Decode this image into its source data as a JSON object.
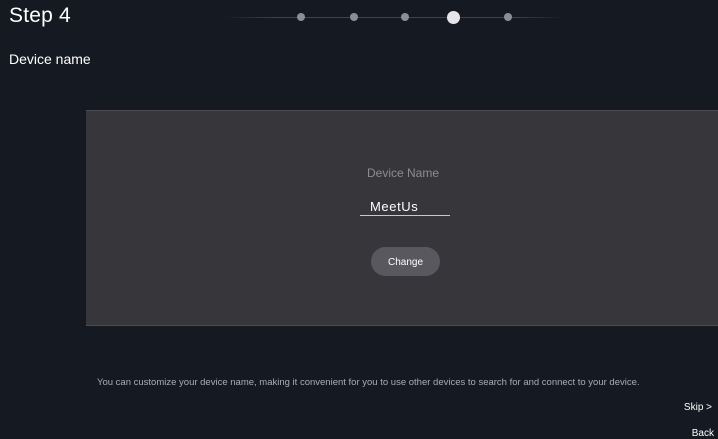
{
  "header": {
    "step_title": "Step 4",
    "subtitle": "Device name",
    "current_step": 4,
    "total_steps": 5
  },
  "panel": {
    "field_label": "Device Name",
    "device_name_value": "MeetUs",
    "change_label": "Change"
  },
  "footer": {
    "description": "You can customize your device name, making it convenient for you to use other devices to search for and connect to your device.",
    "skip_label": "Skip >",
    "back_label": "Back"
  },
  "colors": {
    "background": "#151a22",
    "panel": "#37363b",
    "button": "#59585e",
    "active_dot": "#e6e6ea",
    "inactive_dot": "#8a8f96"
  }
}
